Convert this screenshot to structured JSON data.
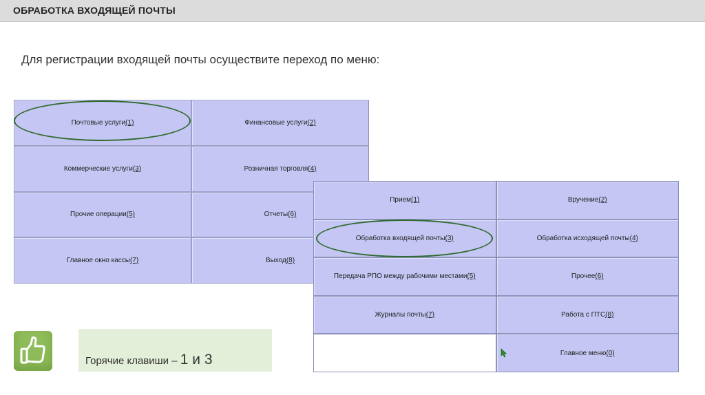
{
  "header": {
    "title": "ОБРАБОТКА ВХОДЯЩЕЙ ПОЧТЫ"
  },
  "instruction": "Для регистрации входящей почты осуществите переход по меню:",
  "main_menu": {
    "items": [
      {
        "label": "Почтовые услуги ",
        "key": "(1)"
      },
      {
        "label": "Финансовые услуги ",
        "key": "(2)"
      },
      {
        "label": "Коммерческие услуги ",
        "key": "(3)"
      },
      {
        "label": "Розничная торговля ",
        "key": "(4)"
      },
      {
        "label": "Прочие операции ",
        "key": "(5)"
      },
      {
        "label": "Отчеты ",
        "key": "(6)"
      },
      {
        "label": "Главное окно кассы ",
        "key": "(7)"
      },
      {
        "label": "Выход ",
        "key": "(8)"
      }
    ]
  },
  "postal_menu": {
    "items": [
      {
        "label": "Прием ",
        "key": "(1)"
      },
      {
        "label": "Вручение ",
        "key": "(2)"
      },
      {
        "label": "Обработка входящей почты ",
        "key": "(3)"
      },
      {
        "label": "Обработка исходящей почты ",
        "key": "(4)"
      },
      {
        "label": "Передача РПО между рабочими местами ",
        "key": "(5)"
      },
      {
        "label": "Прочее ",
        "key": "(6)"
      },
      {
        "label": "Журналы почты",
        "key": "(7)"
      },
      {
        "label": "Работа с ПТС ",
        "key": "(8)"
      },
      {
        "label": "Главное меню ",
        "key": "(0)"
      }
    ]
  },
  "hotkeys": {
    "label": "Горячие клавиши – ",
    "keys": "1 и 3"
  },
  "colors": {
    "menu_cell": "#c5c6f3",
    "highlight_oval": "#2f6b2f",
    "thumb_bg": "#8fbc5a",
    "hotkey_bg": "#e4efd9"
  },
  "icons": {
    "thumb": "thumbs-up-icon",
    "cursor": "cursor-icon"
  }
}
